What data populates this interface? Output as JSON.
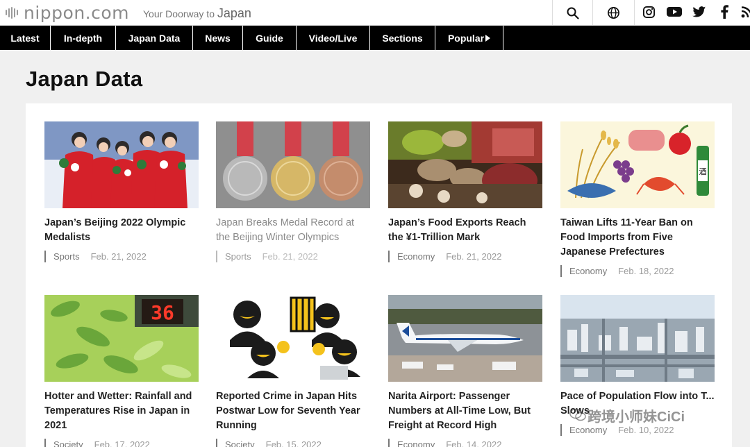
{
  "header": {
    "logo_text": "nippon.com",
    "tagline_small": "Your Doorway to",
    "tagline_big": "Japan"
  },
  "icons": {
    "search": "search-icon",
    "globe": "globe-icon",
    "social": [
      "instagram-icon",
      "youtube-icon",
      "twitter-icon",
      "facebook-icon",
      "rss-icon"
    ]
  },
  "nav": {
    "items": [
      {
        "label": "Latest"
      },
      {
        "label": "In-depth"
      },
      {
        "label": "Japan Data"
      },
      {
        "label": "News"
      },
      {
        "label": "Guide"
      },
      {
        "label": "Video/Live"
      },
      {
        "label": "Sections"
      },
      {
        "label": "Popular"
      }
    ]
  },
  "page": {
    "title": "Japan Data"
  },
  "articles": [
    {
      "title": "Japan’s Beijing 2022 Olympic Medalists",
      "category": "Sports",
      "date": "Feb. 21, 2022"
    },
    {
      "title": "Japan Breaks Medal Record at the Beijing Winter Olympics",
      "category": "Sports",
      "date": "Feb. 21, 2022"
    },
    {
      "title": "Japan’s Food Exports Reach the ¥1-Trillion Mark",
      "category": "Economy",
      "date": "Feb. 21, 2022"
    },
    {
      "title": "Taiwan Lifts 11-Year Ban on Food Imports from Five Japanese Prefectures",
      "category": "Economy",
      "date": "Feb. 18, 2022"
    },
    {
      "title": "Hotter and Wetter: Rainfall and Temperatures Rise in Japan in 2021",
      "category": "Society",
      "date": "Feb. 17, 2022"
    },
    {
      "title": "Reported Crime in Japan Hits Postwar Low for Seventh Year Running",
      "category": "Society",
      "date": "Feb. 15, 2022"
    },
    {
      "title": "Narita Airport: Passenger Numbers at All-Time Low, But Freight at Record High",
      "category": "Economy",
      "date": "Feb. 14, 2022"
    },
    {
      "title": "Pace of Population Flow into T... Slows",
      "category": "Economy",
      "date": "Feb. 10, 2022"
    }
  ],
  "images": {
    "thermometer_text": "36",
    "sake_label": "酒"
  },
  "watermark": "跨境小师妹CiCi",
  "colors": {
    "nav_bg": "#000000",
    "page_bg": "#f0f0f0",
    "panel_bg": "#ffffff",
    "logo_gray": "#8a8a8a"
  }
}
